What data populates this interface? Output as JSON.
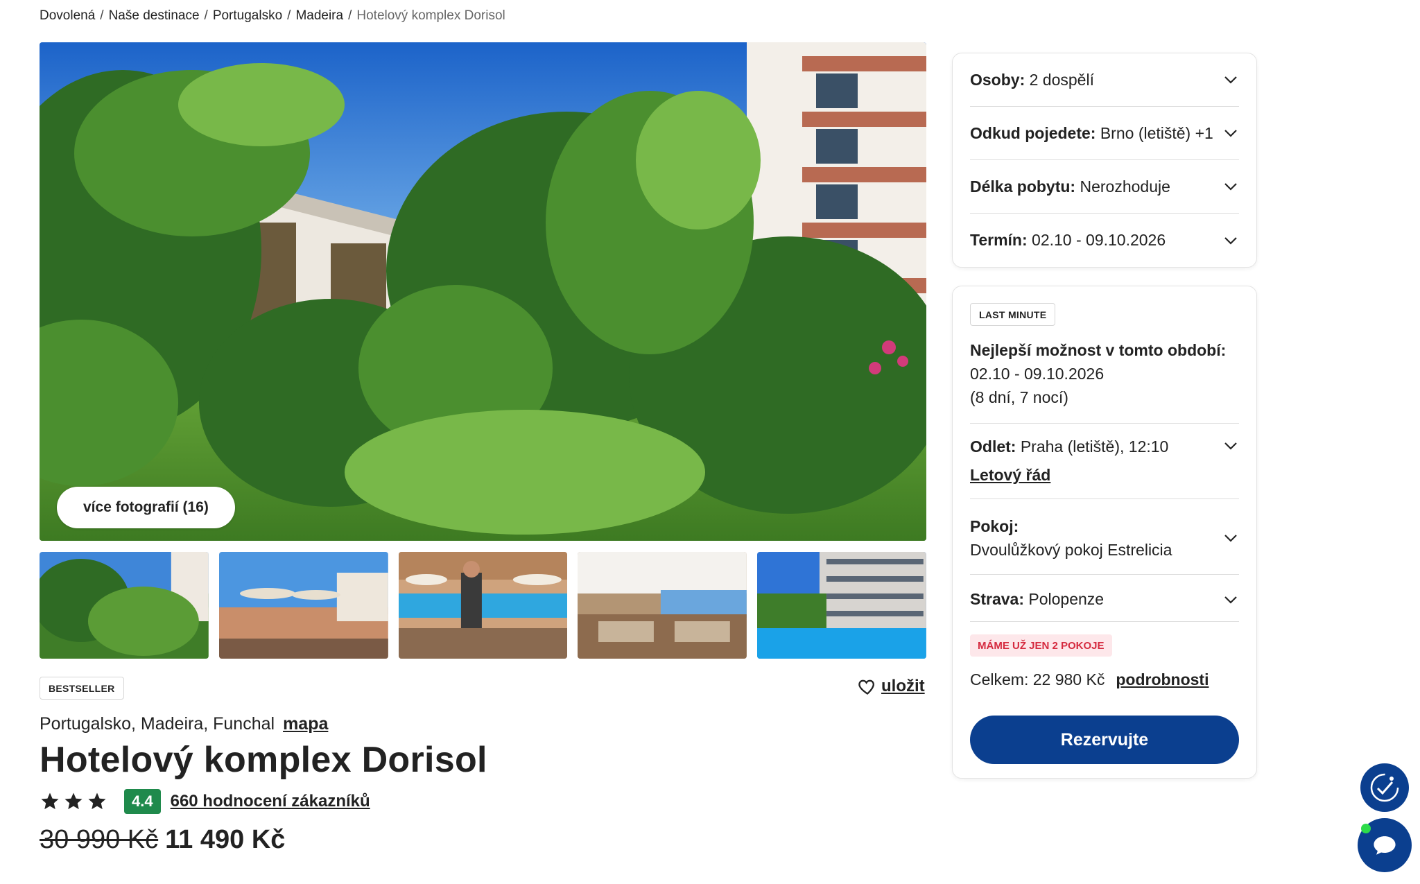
{
  "breadcrumb": {
    "items": [
      "Dovolená",
      "Naše destinace",
      "Portugalsko",
      "Madeira"
    ],
    "current": "Hotelový komplex Dorisol",
    "separator": "/"
  },
  "gallery": {
    "more_photos_label": "více fotografií (16)",
    "thumbnail_count": 5
  },
  "hotel": {
    "badge": "BESTSELLER",
    "save_label": "uložit",
    "location": "Portugalsko, Madeira, Funchal",
    "map_label": "mapa",
    "name": "Hotelový komplex Dorisol",
    "stars": 3,
    "score": "4.4",
    "reviews_label": "660 hodnocení zákazníků",
    "old_price": "30 990 Kč",
    "price": "11 490 Kč"
  },
  "filters": [
    {
      "label": "Osoby:",
      "value": "2 dospělí"
    },
    {
      "label": "Odkud pojedete:",
      "value": "Brno (letiště) +1"
    },
    {
      "label": "Délka pobytu:",
      "value": "Nerozhoduje"
    },
    {
      "label": "Termín:",
      "value": "02.10 - 09.10.2026"
    }
  ],
  "offer": {
    "tag": "LAST MINUTE",
    "best_title": "Nejlepší možnost v tomto období:",
    "best_dates": "02.10 - 09.10.2026",
    "best_duration": "(8 dní, 7 nocí)",
    "departure_label": "Odlet:",
    "departure_value": "Praha (letiště), 12:10",
    "schedule_link": "Letový řád",
    "room_label": "Pokoj:",
    "room_value": "Dvoulůžkový pokoj Estrelicia",
    "board_label": "Strava:",
    "board_value": "Polopenze",
    "availability_warning": "MÁME UŽ JEN 2 POKOJE",
    "total_label": "Celkem:",
    "total_value": "22 980 Kč",
    "details_link": "podrobnosti",
    "reserve_label": "Rezervujte"
  },
  "colors": {
    "primary": "#0b3f8f",
    "score_green": "#1f8a4c",
    "warning_red": "#d52a3f",
    "warning_bg": "#fde7ea"
  },
  "icons": [
    "heart-icon",
    "star-icon",
    "chevron-down-icon",
    "accessibility-icon",
    "chat-icon"
  ]
}
